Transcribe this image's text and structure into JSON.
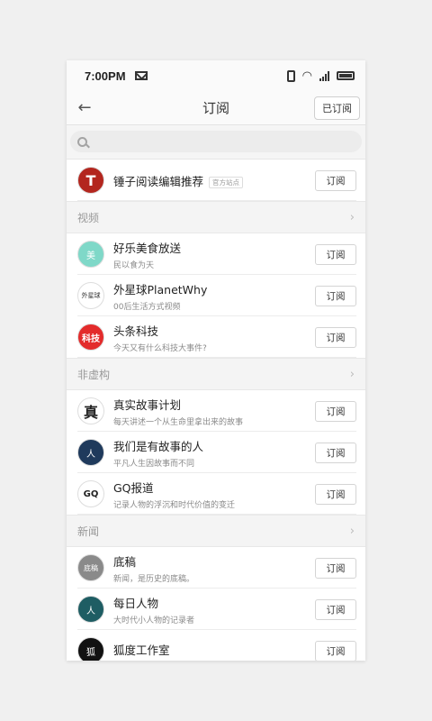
{
  "status": {
    "time": "7:00PM"
  },
  "header": {
    "title": "订阅",
    "subscribed_label": "已订阅",
    "back_glyph": "←"
  },
  "search": {
    "placeholder": ""
  },
  "subscribe_label": "订阅",
  "featured": {
    "name": "锤子阅读编辑推荐",
    "tag": "官方站点",
    "avatar_text": "T",
    "avatar_color": "#b3261e"
  },
  "sections": [
    {
      "title": "视频",
      "items": [
        {
          "name": "好乐美食放送",
          "desc": "民以食为天",
          "avatar_text": "美",
          "avatar_color": "#7fd8c8"
        },
        {
          "name": "外星球PlanetWhy",
          "desc": "00后生活方式视频",
          "avatar_text": "外星球",
          "avatar_color": "#ffffff"
        },
        {
          "name": "头条科技",
          "desc": "今天又有什么科技大事件?",
          "avatar_text": "科技",
          "avatar_color": "#e32b2b"
        }
      ]
    },
    {
      "title": "非虚构",
      "items": [
        {
          "name": "真实故事计划",
          "desc": "每天讲述一个从生命里拿出来的故事",
          "avatar_text": "真",
          "avatar_color": "#ffffff"
        },
        {
          "name": "我们是有故事的人",
          "desc": "平凡人生因故事而不同",
          "avatar_text": "人",
          "avatar_color": "#1f3a5c"
        },
        {
          "name": "GQ报道",
          "desc": "记录人物的浮沉和时代价值的变迁",
          "avatar_text": "GQ",
          "avatar_color": "#ffffff"
        }
      ]
    },
    {
      "title": "新闻",
      "items": [
        {
          "name": "底稿",
          "desc": "新闻，是历史的底稿。",
          "avatar_text": "底稿",
          "avatar_color": "#8a8a8a"
        },
        {
          "name": "每日人物",
          "desc": "大时代小人物的记录者",
          "avatar_text": "人",
          "avatar_color": "#1e5d63"
        },
        {
          "name": "狐度工作室",
          "desc": "",
          "avatar_text": "狐",
          "avatar_color": "#111111"
        }
      ]
    }
  ],
  "colors": {
    "accent_text": "#333333",
    "muted": "#8a8a8a",
    "background": "#f0f0f0"
  },
  "icons": {
    "back": "arrow-left",
    "search": "magnifier",
    "chevron": "chevron-right",
    "mail": "mail",
    "vibrate": "vibrate",
    "wifi": "wifi",
    "signal": "signal",
    "battery": "battery"
  }
}
